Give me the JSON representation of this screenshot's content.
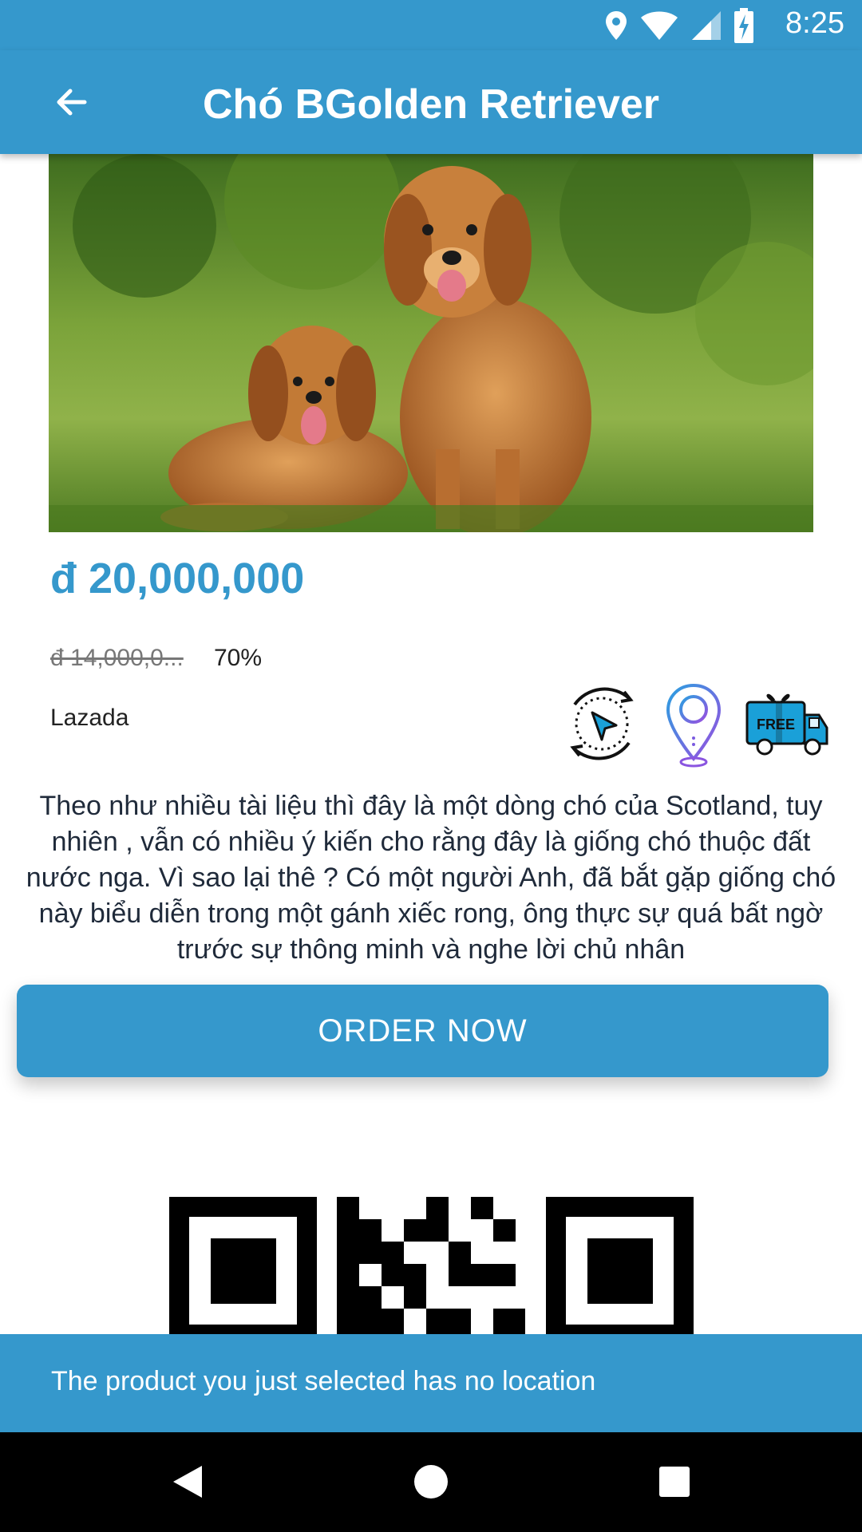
{
  "status_bar": {
    "time": "8:25"
  },
  "app_bar": {
    "title": "Chó BGolden Retriever"
  },
  "product": {
    "price": "đ 20,000,000",
    "old_price": "đ 14,000,0...",
    "discount": "70%",
    "seller": "Lazada",
    "badge_free": "FREE",
    "description": "Theo như nhiều tài liệu thì đây là một dòng chó của Scotland, tuy nhiên , vẫn có nhiều ý kiến cho rằng đây là giống chó thuộc đất nước nga. Vì sao lại thê ? Có một người Anh, đã bắt gặp giống chó này biểu diễn trong một gánh xiếc rong, ông thực sự quá bất ngờ trước sự thông minh và nghe lời chủ nhân"
  },
  "order_button": {
    "label": "ORDER NOW"
  },
  "snackbar": {
    "message": "The product you just selected has no location"
  },
  "colors": {
    "primary": "#3598cc",
    "text_dark": "#1f2a3a"
  },
  "icons": [
    "location-icon",
    "wifi-icon",
    "signal-icon",
    "battery-charging-icon",
    "back-arrow-icon",
    "navigation-cursor-icon",
    "map-pin-icon",
    "free-delivery-truck-icon",
    "qr-code",
    "nav-back-icon",
    "nav-home-icon",
    "nav-recents-icon"
  ]
}
